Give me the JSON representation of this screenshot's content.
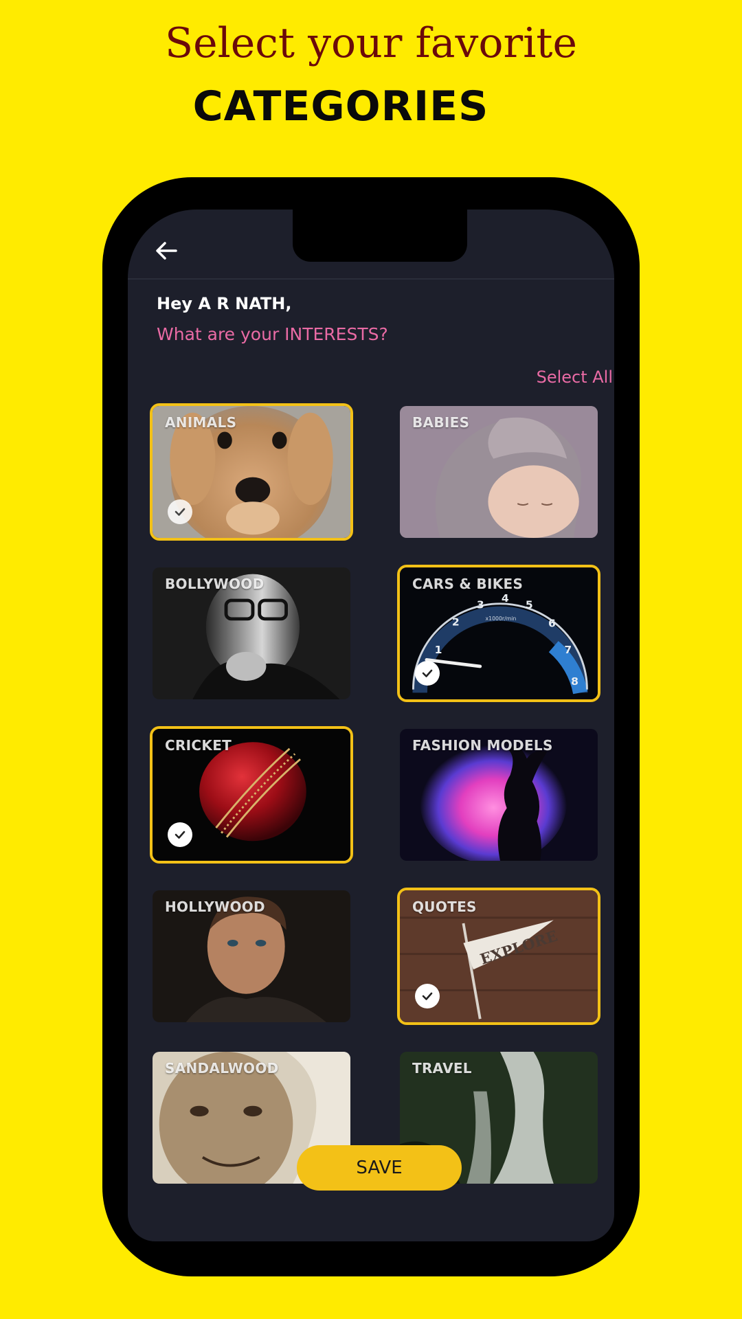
{
  "promo": {
    "line1": "Select your favorite",
    "line2": "CATEGORIES"
  },
  "header": {
    "back_icon": "arrow-left-icon",
    "greeting": "Hey A R NATH,",
    "question": "What are your INTERESTS?",
    "select_all": "Select All"
  },
  "categories": [
    {
      "label": "ANIMALS",
      "selected": true
    },
    {
      "label": "BABIES",
      "selected": false
    },
    {
      "label": "BOLLYWOOD",
      "selected": false
    },
    {
      "label": "CARS & BIKES",
      "selected": true
    },
    {
      "label": "CRICKET",
      "selected": true
    },
    {
      "label": "FASHION MODELS",
      "selected": false
    },
    {
      "label": "HOLLYWOOD",
      "selected": false
    },
    {
      "label": "QUOTES",
      "selected": true
    },
    {
      "label": "SANDALWOOD",
      "selected": false
    },
    {
      "label": "TRAVEL",
      "selected": false
    }
  ],
  "footer": {
    "save_label": "SAVE"
  },
  "colors": {
    "background": "#FFEB00",
    "accent": "#F3C117",
    "pink": "#EA6BA5",
    "screen": "#1D1F2B"
  }
}
